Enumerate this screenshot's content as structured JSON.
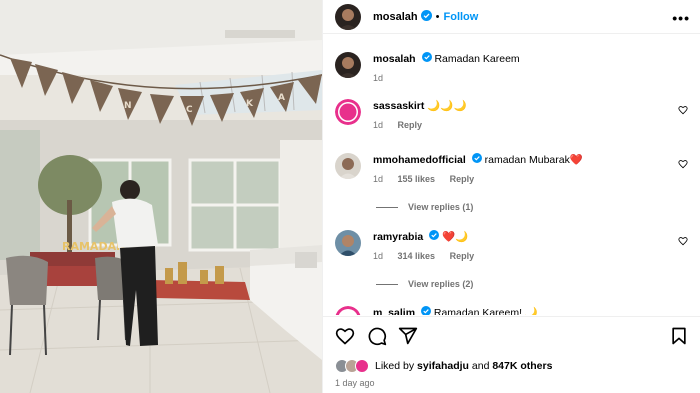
{
  "post": {
    "username": "mosalah",
    "follow_label": "Follow",
    "more_label": "•••",
    "dot": "•"
  },
  "caption": {
    "username": "mosalah",
    "text": "Ramadan Kareem",
    "time": "1d"
  },
  "photo": {
    "banner_text": "RAMADAN",
    "bunting_letters": [
      "N",
      "C",
      "K",
      "A"
    ]
  },
  "comments": [
    {
      "username": "sassaskirt",
      "text": "🌙🌙🌙",
      "time": "1d",
      "likes": "",
      "reply_label": "Reply",
      "verified": false,
      "replies_label": ""
    },
    {
      "username": "mmohamedofficial",
      "text": "ramadan Mubarak❤️",
      "time": "1d",
      "likes": "155 likes",
      "reply_label": "Reply",
      "verified": true,
      "replies_label": "View replies (1)"
    },
    {
      "username": "ramyrabia",
      "text": "❤️🌙",
      "time": "1d",
      "likes": "314 likes",
      "reply_label": "Reply",
      "verified": true,
      "replies_label": "View replies (2)"
    },
    {
      "username": "m_salim",
      "text": "Ramadan Kareem! 🌙",
      "time": "",
      "likes": "",
      "reply_label": "",
      "verified": true,
      "replies_label": ""
    }
  ],
  "likes": {
    "prefix": "Liked by",
    "user": "syifahadju",
    "middle": "and",
    "count": "847K others"
  },
  "time_ago": "1 day ago",
  "colors": {
    "accent": "#0095f6",
    "verified": "#0095f6",
    "meta_gray": "#737373"
  },
  "icons": [
    "heart-icon",
    "comment-icon",
    "share-icon",
    "bookmark-icon",
    "verified-icon",
    "more-icon"
  ]
}
